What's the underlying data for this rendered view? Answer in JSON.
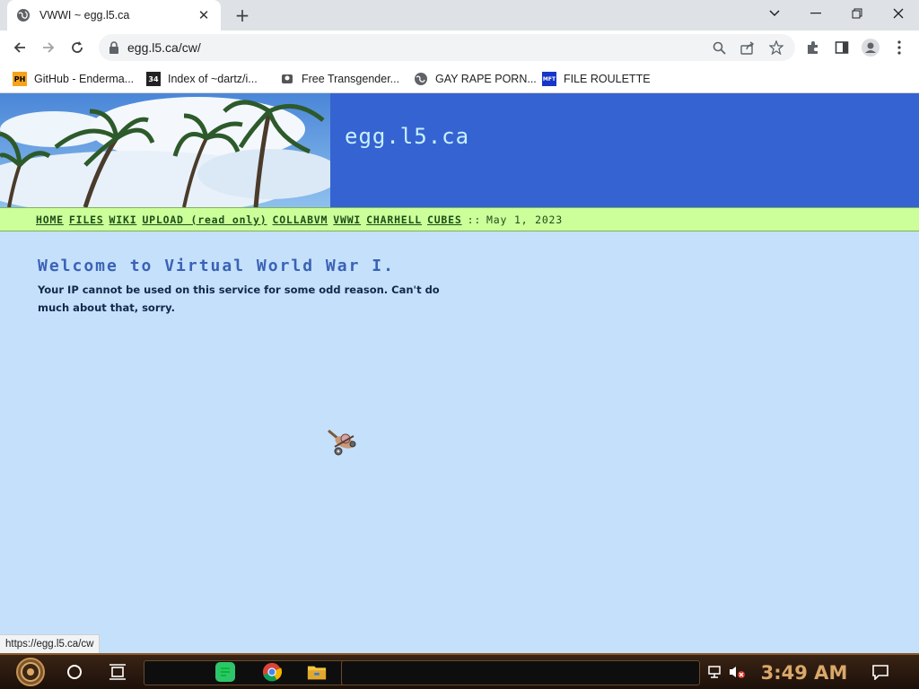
{
  "browser": {
    "tab_title": "VWWI ~ egg.l5.ca",
    "new_tab": "+",
    "url": "egg.l5.ca/cw/",
    "status_url": "https://egg.l5.ca/cw",
    "bookmarks": [
      {
        "label": "GitHub - Enderma...",
        "icon": "PH"
      },
      {
        "label": "Index of ~dartz/i...",
        "icon": "34"
      },
      {
        "label": "Free Transgender...",
        "icon": "badge"
      },
      {
        "label": "GAY RAPE PORN...",
        "icon": "globe"
      },
      {
        "label": "FILE ROULETTE",
        "icon": "MFT"
      }
    ]
  },
  "page": {
    "site_title": "egg.l5.ca",
    "nav": {
      "items": [
        "HOME",
        "FILES",
        "WIKI",
        "UPLOAD (read only)",
        "COLLABVM",
        "VWWI",
        "CHARHELL",
        "CUBES"
      ],
      "separator": "::",
      "date": "May 1, 2023"
    },
    "welcome": "Welcome to Virtual World War I.",
    "message": "Your IP cannot be used on this service for some odd reason. Can't do much about that, sorry."
  },
  "taskbar": {
    "clock": "3:49 AM"
  },
  "colors": {
    "banner": "#3563d1",
    "navbar": "#ccff99",
    "page_bg": "#c5e0fb",
    "heading": "#3a62b5"
  }
}
